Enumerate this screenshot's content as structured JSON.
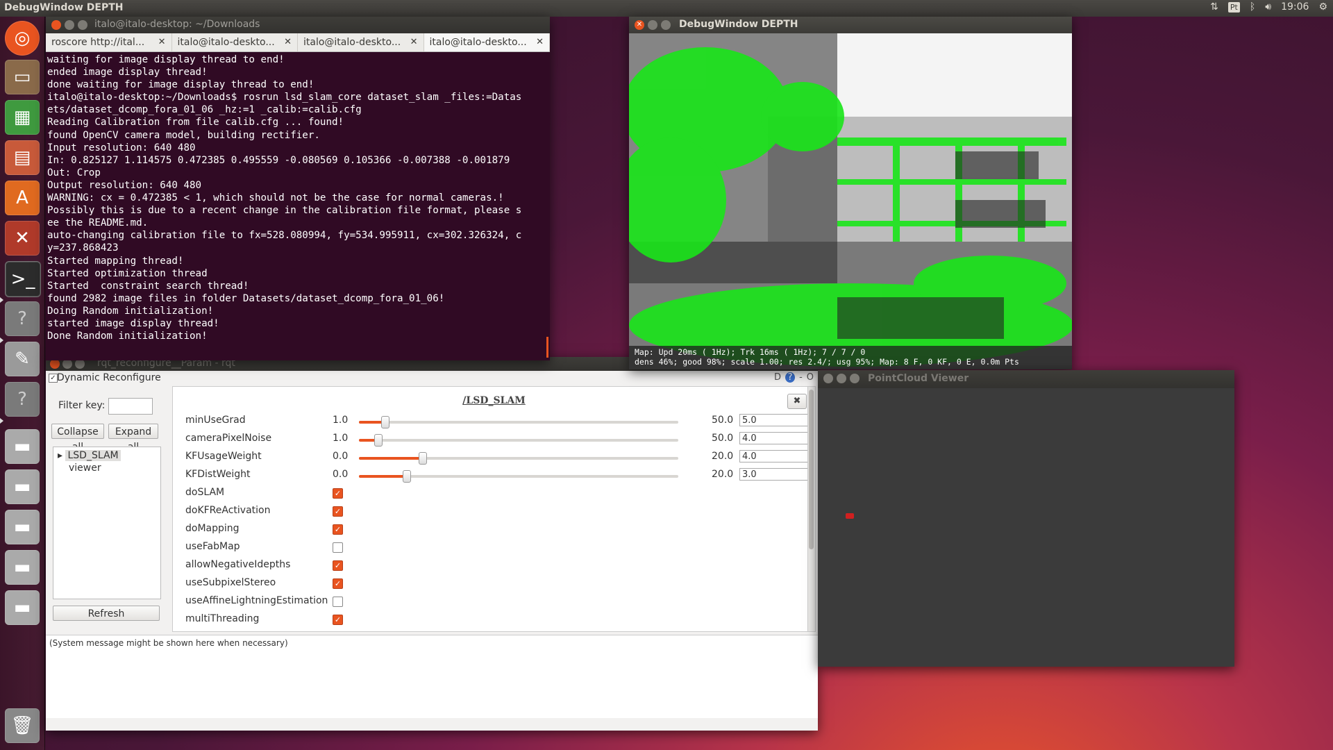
{
  "top_panel": {
    "title": "DebugWindow DEPTH",
    "keyboard": "Pt",
    "clock": "19:06",
    "icons": [
      "network-icon",
      "keyboard-icon",
      "bluetooth-icon",
      "volume-icon",
      "gear-icon"
    ]
  },
  "launcher": {
    "items": [
      "ubuntu-logo-icon",
      "files-icon",
      "spreadsheet-icon",
      "presentation-icon",
      "software-center-icon",
      "settings-icon",
      "terminal-icon",
      "unknown-app-icon",
      "text-editor-icon",
      "unknown-app-icon",
      "drive-icon",
      "drive-icon",
      "drive-icon",
      "drive-icon",
      "drive-icon",
      "trash-icon"
    ]
  },
  "terminal": {
    "title": "italo@italo-desktop: ~/Downloads",
    "tabs": [
      "roscore http://ital...",
      "italo@italo-deskto...",
      "italo@italo-deskto...",
      "italo@italo-deskto..."
    ],
    "lines": [
      "waiting for image display thread to end!",
      "ended image display thread!",
      "done waiting for image display thread to end!",
      "italo@italo-desktop:~/Downloads$ rosrun lsd_slam_core dataset_slam _files:=Datas",
      "ets/dataset_dcomp_fora_01_06 _hz:=1 _calib:=calib.cfg",
      "Reading Calibration from file calib.cfg ... found!",
      "found OpenCV camera model, building rectifier.",
      "Input resolution: 640 480",
      "In: 0.825127 1.114575 0.472385 0.495559 -0.080569 0.105366 -0.007388 -0.001879",
      "Out: Crop",
      "Output resolution: 640 480",
      "WARNING: cx = 0.472385 < 1, which should not be the case for normal cameras.!",
      "Possibly this is due to a recent change in the calibration file format, please s",
      "ee the README.md.",
      "auto-changing calibration file to fx=528.080994, fy=534.995911, cx=302.326324, c",
      "y=237.868423",
      "Started mapping thread!",
      "Started optimization thread",
      "Started  constraint search thread!",
      "found 2982 image files in folder Datasets/dataset_dcomp_fora_01_06!",
      "Doing Random initialization!",
      "started image display thread!",
      "Done Random initialization!"
    ]
  },
  "debug_window": {
    "title": "DebugWindow DEPTH",
    "overlay_line1": "Map: Upd  20ms ( 1Hz); Trk  16ms ( 1Hz); 7 / 7 / 0",
    "overlay_line2": "dens 46%; good 98%; scale 1.00; res 2.4/; usg 95%; Map: 8 F, 0 KF, 0 E, 0.0m Pts"
  },
  "rqt": {
    "title": "rqt_reconfigure__Param - rqt",
    "plugin_label": "Dynamic Reconfigure",
    "header_buttons": [
      "D",
      "?",
      "-",
      "O"
    ],
    "filter_label": "Filter key:",
    "collapse_label": "Collapse all",
    "expand_label": "Expand all",
    "tree": {
      "node1": "LSD_SLAM",
      "node2": "viewer"
    },
    "refresh_label": "Refresh",
    "group_title": "/LSD_SLAM",
    "sliders": [
      {
        "name": "minUseGrad",
        "min": "1.0",
        "max": "50.0",
        "value": "5.0",
        "fraction": 0.082
      },
      {
        "name": "cameraPixelNoise",
        "min": "1.0",
        "max": "50.0",
        "value": "4.0",
        "fraction": 0.061
      },
      {
        "name": "KFUsageWeight",
        "min": "0.0",
        "max": "20.0",
        "value": "4.0",
        "fraction": 0.2
      },
      {
        "name": "KFDistWeight",
        "min": "0.0",
        "max": "20.0",
        "value": "3.0",
        "fraction": 0.15
      }
    ],
    "checkboxes": [
      {
        "name": "doSLAM",
        "checked": true
      },
      {
        "name": "doKFReActivation",
        "checked": true
      },
      {
        "name": "doMapping",
        "checked": true
      },
      {
        "name": "useFabMap",
        "checked": false
      },
      {
        "name": "allowNegativeIdepths",
        "checked": true
      },
      {
        "name": "useSubpixelStereo",
        "checked": true
      },
      {
        "name": "useAffineLightningEstimation",
        "checked": false
      },
      {
        "name": "multiThreading",
        "checked": true
      }
    ],
    "system_message": "(System message might be shown here when necessary)"
  },
  "pointcloud": {
    "title": "PointCloud Viewer"
  },
  "colors": {
    "accent": "#e95420",
    "terminal_bg": "#300a24",
    "depth_green": "#19e619"
  }
}
